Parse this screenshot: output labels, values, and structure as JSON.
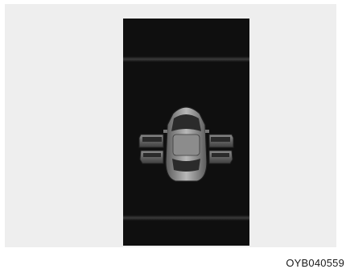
{
  "figure": {
    "code": "OYB040559"
  },
  "display": {
    "icon": "car-doors-open-icon",
    "colors": {
      "background": "#eeeeee",
      "screen": "#0f0f0f",
      "car_body": "#9a9a9a",
      "door": "#6a6a6a"
    }
  }
}
